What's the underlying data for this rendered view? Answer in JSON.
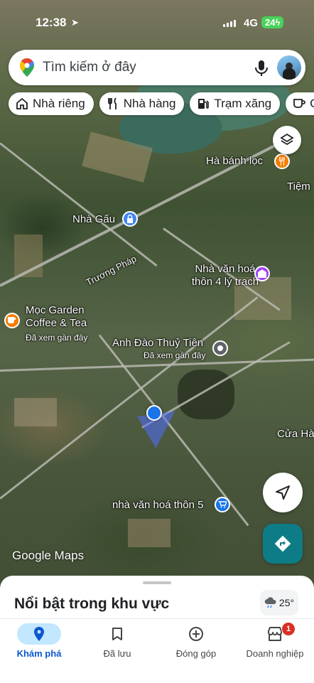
{
  "status_bar": {
    "time": "12:38",
    "network": "4G",
    "battery": "24"
  },
  "search": {
    "placeholder": "Tìm kiếm ở đây"
  },
  "chips": [
    {
      "label": "Nhà riêng",
      "icon": "home-icon"
    },
    {
      "label": "Nhà hàng",
      "icon": "restaurant-icon"
    },
    {
      "label": "Trạm xăng",
      "icon": "gas-station-icon"
    },
    {
      "label": "C",
      "icon": "coffee-icon"
    }
  ],
  "map": {
    "places": [
      {
        "name": "Hà bánh lọc",
        "icon": "restaurant-icon",
        "color": "#f57c00"
      },
      {
        "name": "Tiệm"
      },
      {
        "name": "Nhà Gấu",
        "icon": "lock-icon",
        "color": "#4285f4"
      },
      {
        "name": "Trương Pháp"
      },
      {
        "name": "Nhà văn hoá\nthôn 4 lý trạch",
        "icon": "community-icon",
        "color": "#a142f4"
      },
      {
        "name": "Mọc Garden\nCoffee & Tea",
        "sub": "Đã xem gần đây",
        "icon": "coffee-icon",
        "color": "#f57c00"
      },
      {
        "name": "Anh Đào Thuỷ Tiên",
        "sub": "Đã xem gần đây",
        "icon": "saved-place-icon",
        "color": "#5f6368"
      },
      {
        "name": "Cửa Hà"
      },
      {
        "name": "nhà văn hoá thôn 5",
        "icon": "shopping-icon",
        "color": "#1a73e8"
      }
    ],
    "attribution": "Google Maps"
  },
  "sheet": {
    "title": "Nổi bật trong khu vực",
    "weather": "25°"
  },
  "nav": [
    {
      "label": "Khám phá",
      "icon": "explore-pin-icon",
      "active": true
    },
    {
      "label": "Đã lưu",
      "icon": "bookmark-icon"
    },
    {
      "label": "Đóng góp",
      "icon": "add-circle-icon"
    },
    {
      "label": "Doanh nghiệp",
      "icon": "store-icon",
      "badge": "1"
    }
  ]
}
